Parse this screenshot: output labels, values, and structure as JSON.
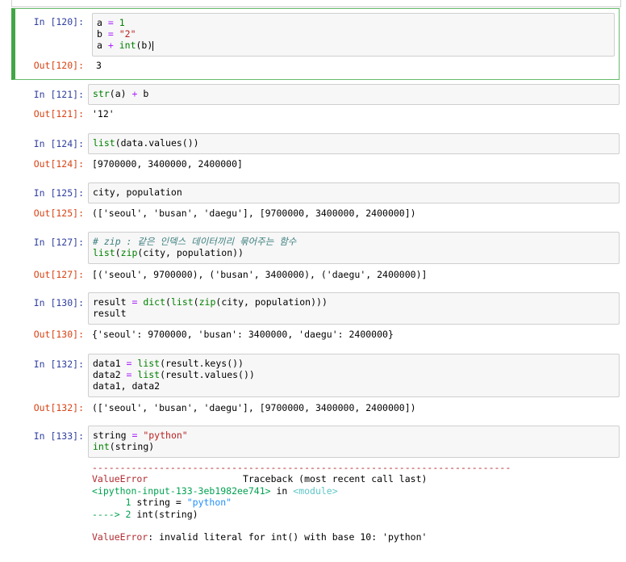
{
  "cells": [
    {
      "in_prompt": "In [120]:",
      "out_prompt": "Out[120]:",
      "lines": [
        [
          "a",
          " = ",
          "1"
        ],
        [
          "b",
          " = ",
          "\"2\""
        ],
        [
          "a",
          " + ",
          "int",
          "(b)"
        ]
      ],
      "output": "3"
    },
    {
      "in_prompt": "In [121]:",
      "out_prompt": "Out[121]:",
      "lines": [
        [
          "str",
          "(a)",
          " + ",
          "b"
        ]
      ],
      "output": "'12'"
    },
    {
      "in_prompt": "In [124]:",
      "out_prompt": "Out[124]:",
      "lines": [
        [
          "list",
          "(data.values())"
        ]
      ],
      "output": "[9700000, 3400000, 2400000]"
    },
    {
      "in_prompt": "In [125]:",
      "out_prompt": "Out[125]:",
      "lines": [
        [
          "city, population"
        ]
      ],
      "output": "(['seoul', 'busan', 'daegu'], [9700000, 3400000, 2400000])"
    },
    {
      "in_prompt": "In [127]:",
      "out_prompt": "Out[127]:",
      "lines": [
        [
          "# zip : 같은 인덱스 데이터끼리 묶어주는 함수"
        ],
        [
          "list",
          "(",
          "zip",
          "(city, population))"
        ]
      ],
      "output": "[('seoul', 9700000), ('busan', 3400000), ('daegu', 2400000)]"
    },
    {
      "in_prompt": "In [130]:",
      "out_prompt": "Out[130]:",
      "lines": [
        [
          "result",
          " = ",
          "dict",
          "(",
          "list",
          "(",
          "zip",
          "(city, population)))"
        ],
        [
          "result"
        ]
      ],
      "output": "{'seoul': 9700000, 'busan': 3400000, 'daegu': 2400000}"
    },
    {
      "in_prompt": "In [132]:",
      "out_prompt": "Out[132]:",
      "lines": [
        [
          "data1",
          " = ",
          "list",
          "(result.keys())"
        ],
        [
          "data2",
          " = ",
          "list",
          "(result.values())"
        ],
        [
          "data1, data2"
        ]
      ],
      "output": "(['seoul', 'busan', 'daegu'], [9700000, 3400000, 2400000])"
    },
    {
      "in_prompt": "In [133]:",
      "lines": [
        [
          "string",
          " = ",
          "\"python\""
        ],
        [
          "int",
          "(string)"
        ]
      ],
      "traceback": {
        "rule": "---------------------------------------------------------------------------",
        "error_name": "ValueError",
        "header_tail": "                 Traceback (most recent call last)",
        "input_ref": "<ipython-input-133-3eb1982ee741>",
        "in_word": " in ",
        "module_ref": "<module>",
        "line1_no": "      1 ",
        "line1_code_a": "string",
        "line1_code_op": " = ",
        "line1_code_str": "\"python\"",
        "arrow": "----> 2 ",
        "line2_code": "int(string)",
        "final_name": "ValueError",
        "final_msg": ": invalid literal for int() with base 10: 'python'"
      }
    }
  ]
}
